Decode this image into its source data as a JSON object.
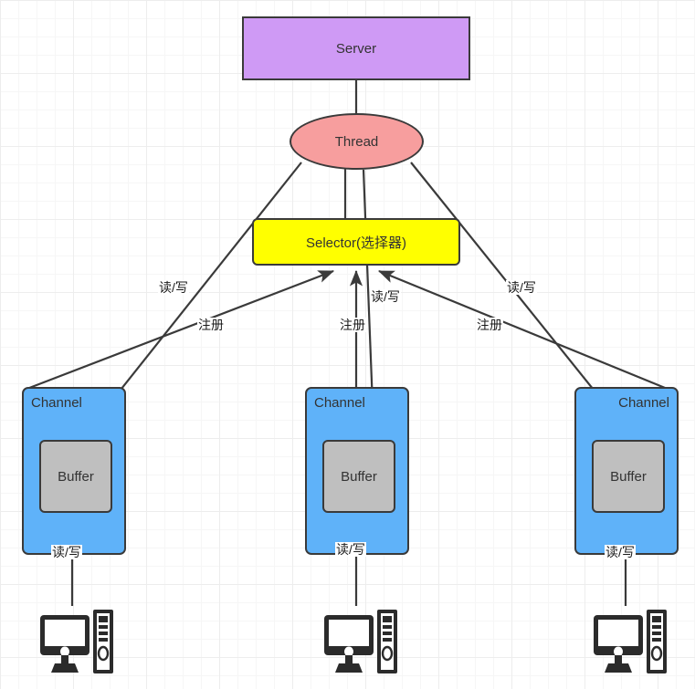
{
  "diagram": {
    "title": "NIO Server Thread Selector Channel Buffer architecture",
    "background": "#ffffff",
    "grid_minor_color": "#f6f6f6",
    "grid_major_color": "#ededed",
    "nodes": {
      "server": {
        "label": "Server",
        "fill": "#cf9af5",
        "stroke": "#3a3a3a",
        "shape": "rect"
      },
      "thread": {
        "label": "Thread",
        "fill": "#f79e9e",
        "stroke": "#3a3a3a",
        "shape": "ellipse"
      },
      "selector": {
        "label": "Selector(选择器)",
        "fill": "#ffff00",
        "stroke": "#3a3a3a",
        "shape": "rounded-rect"
      },
      "channels": [
        {
          "label": "Channel",
          "fill": "#5fb2f9",
          "stroke": "#3a3a3a",
          "label_align": "left",
          "buffer": {
            "label": "Buffer",
            "fill": "#bfbfbf",
            "stroke": "#3a3a3a"
          }
        },
        {
          "label": "Channel",
          "fill": "#5fb2f9",
          "stroke": "#3a3a3a",
          "label_align": "left",
          "buffer": {
            "label": "Buffer",
            "fill": "#bfbfbf",
            "stroke": "#3a3a3a"
          }
        },
        {
          "label": "Channel",
          "fill": "#5fb2f9",
          "stroke": "#3a3a3a",
          "label_align": "right",
          "buffer": {
            "label": "Buffer",
            "fill": "#bfbfbf",
            "stroke": "#3a3a3a"
          }
        }
      ],
      "clients": [
        {
          "icon": "desktop-computer-icon"
        },
        {
          "icon": "desktop-computer-icon"
        },
        {
          "icon": "desktop-computer-icon"
        }
      ]
    },
    "edge_labels": {
      "read_write_left": "读/写",
      "register_left": "注册",
      "read_write_middle": "读/写",
      "register_middle": "注册",
      "read_write_right": "读/写",
      "register_right": "注册",
      "client_read_write_left": "读/写",
      "client_read_write_middle": "读/写",
      "client_read_write_right": "读/写"
    },
    "edges": [
      {
        "from": "server",
        "to": "thread",
        "arrow": false
      },
      {
        "from": "thread",
        "to": "selector",
        "arrow": false
      },
      {
        "from": "thread",
        "to": "channel-1-buffer",
        "label": "读/写",
        "arrow": false
      },
      {
        "from": "thread",
        "to": "channel-2-buffer",
        "label": "读/写",
        "arrow": false
      },
      {
        "from": "thread",
        "to": "channel-3-buffer",
        "label": "读/写",
        "arrow": false
      },
      {
        "from": "channel-1",
        "to": "selector",
        "label": "注册",
        "arrow": true
      },
      {
        "from": "channel-2",
        "to": "selector",
        "label": "注册",
        "arrow": true
      },
      {
        "from": "channel-3",
        "to": "selector",
        "label": "注册",
        "arrow": true
      },
      {
        "from": "channel-1-buffer",
        "to": "client-1",
        "label": "读/写",
        "arrow": false
      },
      {
        "from": "channel-2-buffer",
        "to": "client-2",
        "label": "读/写",
        "arrow": false
      },
      {
        "from": "channel-3-buffer",
        "to": "client-3",
        "label": "读/写",
        "arrow": false
      }
    ]
  }
}
